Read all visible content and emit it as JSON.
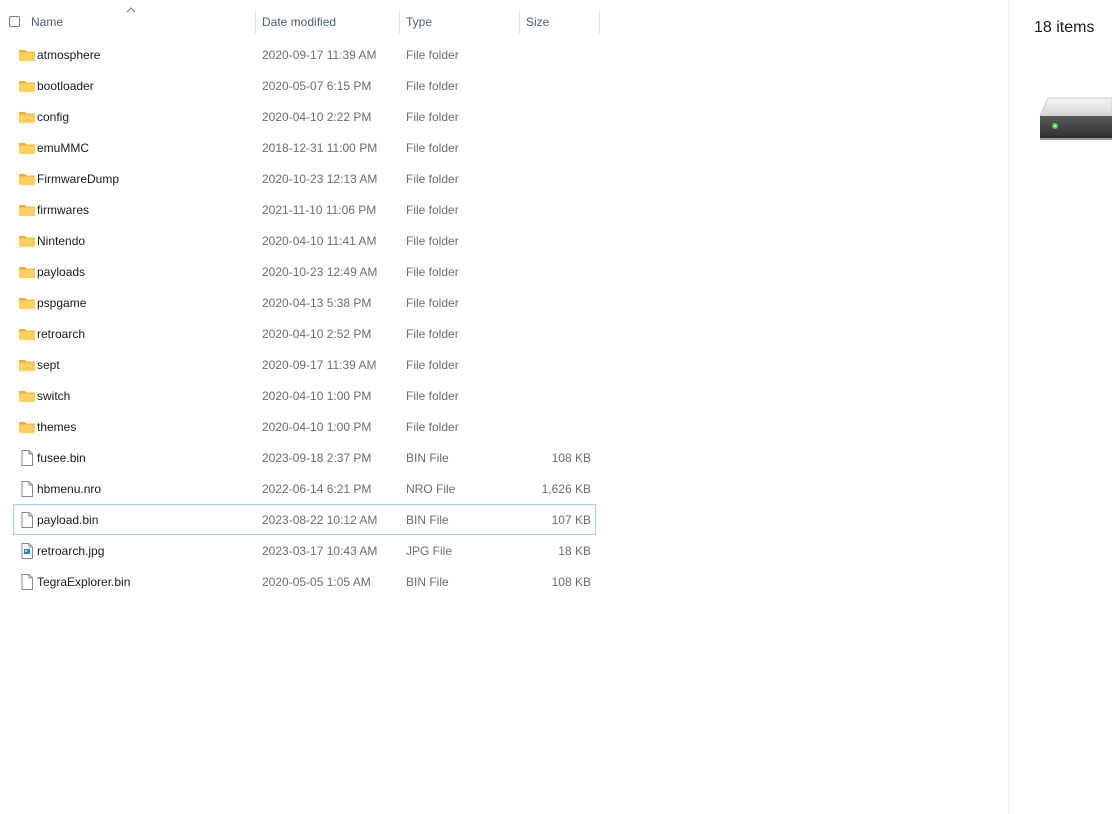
{
  "header": {
    "columns": {
      "name": "Name",
      "date": "Date modified",
      "type": "Type",
      "size": "Size"
    },
    "sort": {
      "column": "name",
      "direction": "ascending",
      "icon": "chevron-up-icon"
    }
  },
  "details_pane": {
    "item_count": "18 items",
    "icon": "drive-icon"
  },
  "files": [
    {
      "name": "atmosphere",
      "date": "2020-09-17 11:39 AM",
      "type": "File folder",
      "size": "",
      "icon": "folder-icon"
    },
    {
      "name": "bootloader",
      "date": "2020-05-07 6:15 PM",
      "type": "File folder",
      "size": "",
      "icon": "folder-icon"
    },
    {
      "name": "config",
      "date": "2020-04-10 2:22 PM",
      "type": "File folder",
      "size": "",
      "icon": "folder-icon"
    },
    {
      "name": "emuMMC",
      "date": "2018-12-31 11:00 PM",
      "type": "File folder",
      "size": "",
      "icon": "folder-icon"
    },
    {
      "name": "FirmwareDump",
      "date": "2020-10-23 12:13 AM",
      "type": "File folder",
      "size": "",
      "icon": "folder-icon"
    },
    {
      "name": "firmwares",
      "date": "2021-11-10 11:06 PM",
      "type": "File folder",
      "size": "",
      "icon": "folder-icon"
    },
    {
      "name": "Nintendo",
      "date": "2020-04-10 11:41 AM",
      "type": "File folder",
      "size": "",
      "icon": "folder-icon"
    },
    {
      "name": "payloads",
      "date": "2020-10-23 12:49 AM",
      "type": "File folder",
      "size": "",
      "icon": "folder-icon"
    },
    {
      "name": "pspgame",
      "date": "2020-04-13 5:38 PM",
      "type": "File folder",
      "size": "",
      "icon": "folder-icon"
    },
    {
      "name": "retroarch",
      "date": "2020-04-10 2:52 PM",
      "type": "File folder",
      "size": "",
      "icon": "folder-icon"
    },
    {
      "name": "sept",
      "date": "2020-09-17 11:39 AM",
      "type": "File folder",
      "size": "",
      "icon": "folder-icon"
    },
    {
      "name": "switch",
      "date": "2020-04-10 1:00 PM",
      "type": "File folder",
      "size": "",
      "icon": "folder-icon"
    },
    {
      "name": "themes",
      "date": "2020-04-10 1:00 PM",
      "type": "File folder",
      "size": "",
      "icon": "folder-icon"
    },
    {
      "name": "fusee.bin",
      "date": "2023-09-18 2:37 PM",
      "type": "BIN File",
      "size": "108 KB",
      "icon": "file-icon"
    },
    {
      "name": "hbmenu.nro",
      "date": "2022-06-14 6:21 PM",
      "type": "NRO File",
      "size": "1,626 KB",
      "icon": "file-icon"
    },
    {
      "name": "payload.bin",
      "date": "2023-08-22 10:12 AM",
      "type": "BIN File",
      "size": "107 KB",
      "icon": "file-icon",
      "selected": true
    },
    {
      "name": "retroarch.jpg",
      "date": "2023-03-17 10:43 AM",
      "type": "JPG File",
      "size": "18 KB",
      "icon": "image-file-icon"
    },
    {
      "name": "TegraExplorer.bin",
      "date": "2020-05-05 1:05 AM",
      "type": "BIN File",
      "size": "108 KB",
      "icon": "file-icon"
    }
  ]
}
